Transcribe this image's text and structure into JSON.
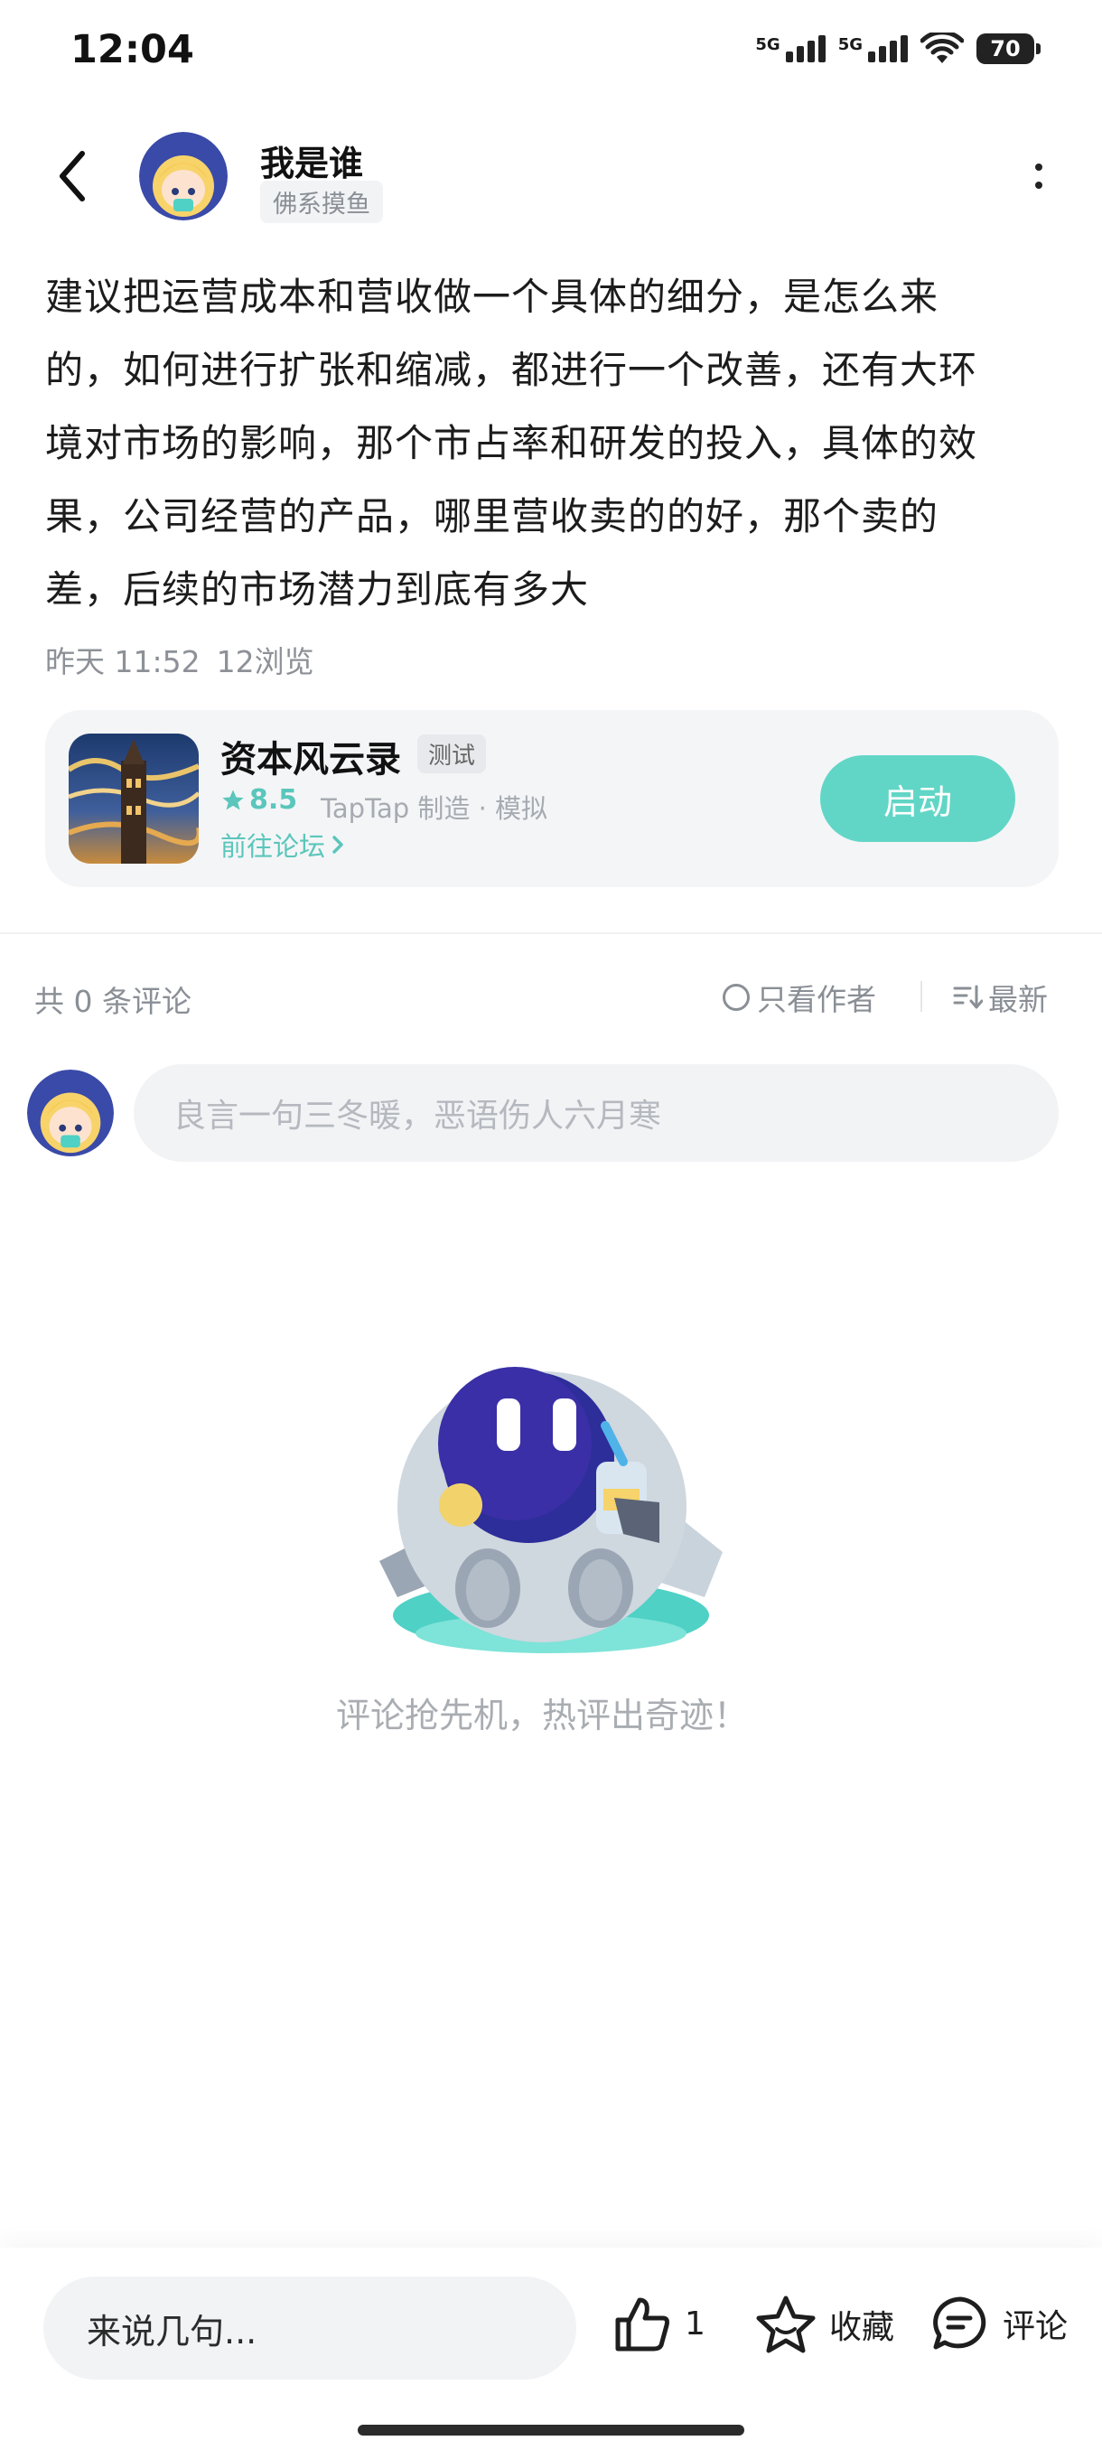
{
  "status_bar": {
    "time": "12:04",
    "network1": "5G",
    "network2": "5G",
    "battery": "70"
  },
  "header": {
    "author_name": "我是谁",
    "author_tag": "佛系摸鱼"
  },
  "post": {
    "lines": [
      "建议把运营成本和营收做一个具体的细分，是怎么来",
      "的，如何进行扩张和缩减，都进行一个改善，还有大环",
      "境对市场的影响，那个市占率和研发的投入，具体的效",
      "果，公司经营的产品，哪里营收卖的的好，那个卖的",
      "差，后续的市场潜力到底有多大"
    ],
    "time": "昨天 11:52",
    "views": "12浏览"
  },
  "game_card": {
    "name": "资本风云录",
    "tag": "测试",
    "rating": "8.5",
    "maker": "TapTap 制造 · 模拟",
    "forum_link": "前往论坛",
    "launch_label": "启动",
    "accent_color": "#62d6c6"
  },
  "comments": {
    "count_label": "共 0 条评论",
    "author_only_label": "只看作者",
    "sort_label": "最新",
    "input_placeholder": "良言一句三冬暖，恶语伤人六月寒",
    "empty_text": "评论抢先机，热评出奇迹！"
  },
  "bottom_bar": {
    "reply_placeholder": "来说几句...",
    "like_count": "1",
    "favorite_label": "收藏",
    "comment_label": "评论"
  },
  "icons": [
    "back-icon",
    "more-icon",
    "star-icon",
    "chevron-right-icon",
    "radio-icon",
    "sort-icon",
    "thumbs-up-icon",
    "favorite-star-icon",
    "comment-bubble-icon"
  ]
}
